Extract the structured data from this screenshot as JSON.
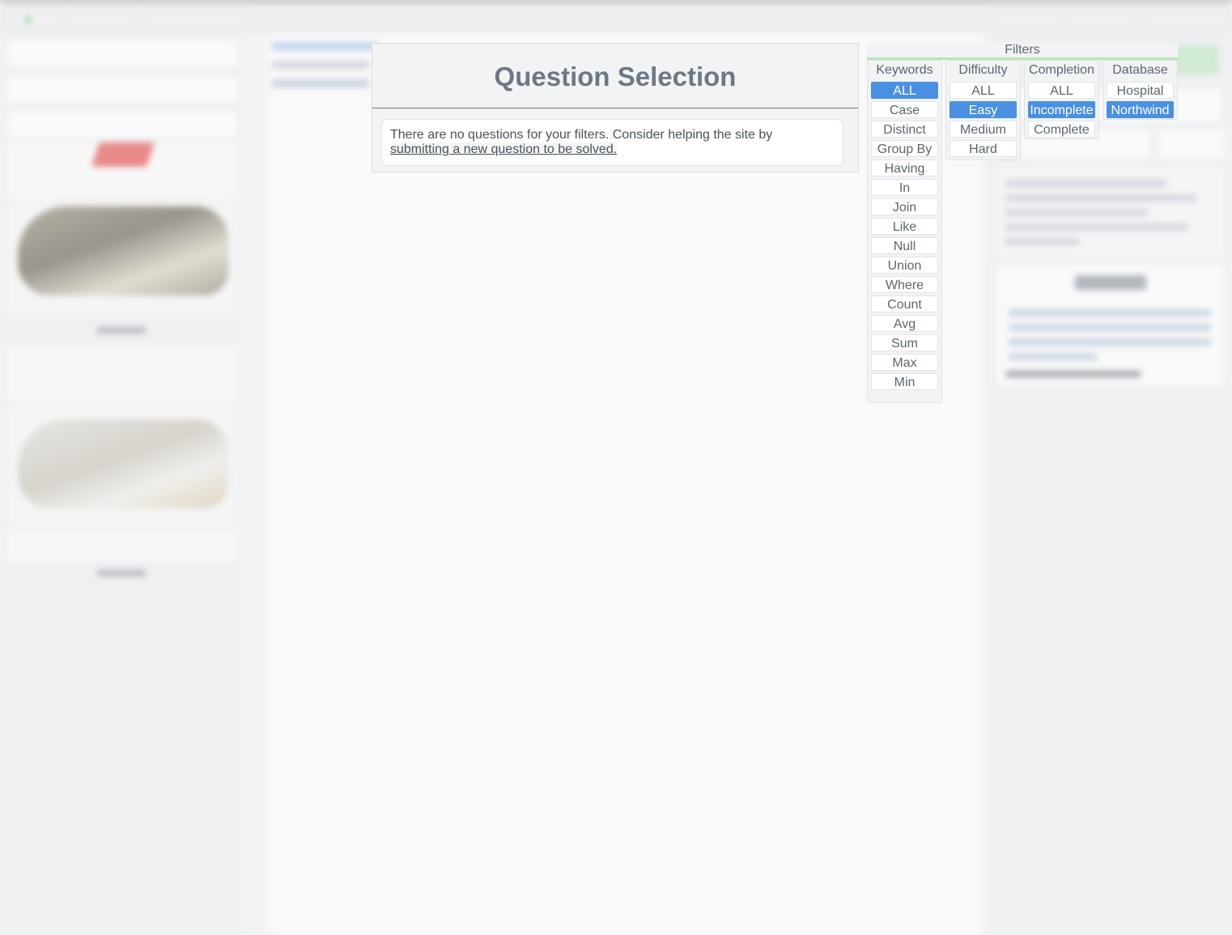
{
  "modal": {
    "title": "Question Selection",
    "message": "There are no questions for your filters. Consider helping the site by",
    "link_text": "submitting a new question to be solved."
  },
  "filters": {
    "title": "Filters",
    "keywords": {
      "heading": "Keywords",
      "selected": "ALL",
      "options": [
        "ALL",
        "Case",
        "Distinct",
        "Group By",
        "Having",
        "In",
        "Join",
        "Like",
        "Null",
        "Union",
        "Where",
        "Count",
        "Avg",
        "Sum",
        "Max",
        "Min"
      ]
    },
    "difficulty": {
      "heading": "Difficulty",
      "selected": "Easy",
      "options": [
        "ALL",
        "Easy",
        "Medium",
        "Hard"
      ]
    },
    "completion": {
      "heading": "Completion",
      "selected": "Incomplete",
      "options": [
        "ALL",
        "Incomplete",
        "Complete"
      ]
    },
    "database": {
      "heading": "Database",
      "selected": "Northwind",
      "options": [
        "Hospital",
        "Northwind"
      ]
    }
  },
  "colors": {
    "selected": "#4a90e2",
    "title_text": "#6d7884",
    "run_button": "#bfe8bf"
  }
}
